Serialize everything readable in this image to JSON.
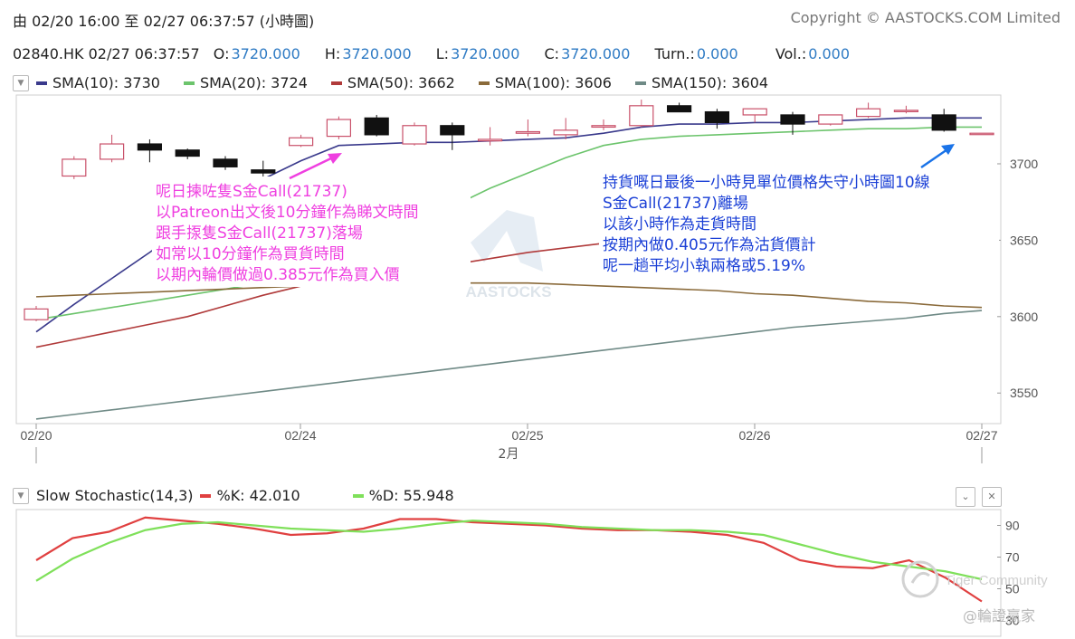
{
  "header": {
    "range_text": "由 02/20 16:00 至 02/27 06:37:57 (小時圖)",
    "copyright": "Copyright © AASTOCKS.COM Limited"
  },
  "quote": {
    "symbol_time": "02840.HK 02/27 06:37:57",
    "o_label": "O:",
    "o_value": "3720.000",
    "h_label": "H:",
    "h_value": "3720.000",
    "l_label": "L:",
    "l_value": "3720.000",
    "c_label": "C:",
    "c_value": "3720.000",
    "turn_label": "Turn.:",
    "turn_value": "0.000",
    "vol_label": "Vol.:",
    "vol_value": "0.000"
  },
  "legend": [
    {
      "label": "SMA(10): 3730",
      "color": "#3a3a8c"
    },
    {
      "label": "SMA(20): 3724",
      "color": "#6cc46c"
    },
    {
      "label": "SMA(50): 3662",
      "color": "#b03a3a"
    },
    {
      "label": "SMA(100): 3606",
      "color": "#8a6a3a"
    },
    {
      "label": "SMA(150): 3604",
      "color": "#6f8a86"
    }
  ],
  "annotations": {
    "pink": [
      "呢日揀咗隻S金Call(21737)",
      "以Patreon出文後10分鐘作為睇文時間",
      "跟手揼隻S金Call(21737)落場",
      "如常以10分鐘作為買貨時間",
      "以期內輪價做過0.385元作為買入價"
    ],
    "blue": [
      "持貨嘅日最後一小時見單位價格失守小時圖10線",
      "S金Call(21737)離場",
      "以該小時作為走貨時間",
      "按期內做0.405元作為沽貨價計",
      "呢一趟平均小執兩格或5.19%"
    ]
  },
  "watermark": "AASTOCKS",
  "stoch_header": {
    "title": "Slow Stochastic(14,3)",
    "k_label": "%K: 42.010",
    "d_label": "%D: 55.948"
  },
  "tiger": {
    "brand": "Tiger Community",
    "handle": "@輪證贏家"
  },
  "chart_data": [
    {
      "type": "candlestick",
      "y_ticks": [
        "3700",
        "3650",
        "3600",
        "3550"
      ],
      "ylim": [
        3530,
        3745
      ],
      "x_ticks": [
        "02/20",
        "02/24",
        "02/25",
        "02/26",
        "02/27"
      ],
      "x_sublabel": "2月",
      "candles": [
        {
          "o": 3598,
          "h": 3607,
          "l": 3597,
          "c": 3605
        },
        {
          "o": 3692,
          "h": 3705,
          "l": 3690,
          "c": 3703
        },
        {
          "o": 3703,
          "h": 3719,
          "l": 3701,
          "c": 3713
        },
        {
          "o": 3713,
          "h": 3716,
          "l": 3701,
          "c": 3709
        },
        {
          "o": 3709,
          "h": 3710,
          "l": 3703,
          "c": 3705
        },
        {
          "o": 3703,
          "h": 3705,
          "l": 3696,
          "c": 3698
        },
        {
          "o": 3696,
          "h": 3702,
          "l": 3690,
          "c": 3694
        },
        {
          "o": 3712,
          "h": 3719,
          "l": 3711,
          "c": 3717
        },
        {
          "o": 3718,
          "h": 3731,
          "l": 3716,
          "c": 3729
        },
        {
          "o": 3730,
          "h": 3732,
          "l": 3718,
          "c": 3719
        },
        {
          "o": 3713,
          "h": 3727,
          "l": 3712,
          "c": 3725
        },
        {
          "o": 3725,
          "h": 3727,
          "l": 3709,
          "c": 3719
        },
        {
          "o": 3715,
          "h": 3724,
          "l": 3712,
          "c": 3716
        },
        {
          "o": 3720,
          "h": 3729,
          "l": 3718,
          "c": 3721
        },
        {
          "o": 3719,
          "h": 3730,
          "l": 3716,
          "c": 3722
        },
        {
          "o": 3724,
          "h": 3729,
          "l": 3722,
          "c": 3725
        },
        {
          "o": 3725,
          "h": 3742,
          "l": 3724,
          "c": 3738
        },
        {
          "o": 3738,
          "h": 3740,
          "l": 3734,
          "c": 3734
        },
        {
          "o": 3734,
          "h": 3736,
          "l": 3723,
          "c": 3727
        },
        {
          "o": 3732,
          "h": 3736,
          "l": 3727,
          "c": 3736
        },
        {
          "o": 3732,
          "h": 3734,
          "l": 3719,
          "c": 3726
        },
        {
          "o": 3726,
          "h": 3732,
          "l": 3725,
          "c": 3732
        },
        {
          "o": 3731,
          "h": 3740,
          "l": 3730,
          "c": 3736
        },
        {
          "o": 3735,
          "h": 3738,
          "l": 3733,
          "c": 3735
        },
        {
          "o": 3732,
          "h": 3736,
          "l": 3721,
          "c": 3722
        },
        {
          "o": 3720,
          "h": 3720,
          "l": 3720,
          "c": 3720
        }
      ],
      "sma": {
        "SMA(10)": [
          3590,
          3608,
          3625,
          3642,
          3660,
          3678,
          3690,
          3702,
          3712,
          3713,
          3714,
          3714,
          3715,
          3716,
          3717,
          3720,
          3724,
          3726,
          3726,
          3727,
          3727,
          3728,
          3729,
          3730,
          3730,
          3730
        ],
        "SMA(20)": [
          3598,
          3602,
          3606,
          3610,
          3614,
          3618,
          3622,
          3630,
          3640,
          3650,
          3662,
          3672,
          3684,
          3694,
          3704,
          3712,
          3716,
          3718,
          3719,
          3720,
          3721,
          3722,
          3723,
          3723,
          3724,
          3724
        ],
        "SMA(50)": [
          3580,
          3585,
          3590,
          3595,
          3600,
          3607,
          3614,
          3620,
          3625,
          3628,
          3631,
          3634,
          3638,
          3642,
          3645,
          3648,
          3651,
          3654,
          3656,
          3658,
          3659,
          3660,
          3661,
          3661,
          3662,
          3662
        ],
        "SMA(100)": [
          3613,
          3614,
          3615,
          3616,
          3617,
          3618,
          3619,
          3620,
          3621,
          3622,
          3622,
          3622,
          3622,
          3622,
          3621,
          3620,
          3619,
          3618,
          3617,
          3615,
          3614,
          3612,
          3610,
          3609,
          3607,
          3606
        ],
        "SMA(150)": [
          3533,
          3536,
          3539,
          3542,
          3545,
          3548,
          3551,
          3554,
          3557,
          3560,
          3563,
          3566,
          3569,
          3572,
          3575,
          3578,
          3581,
          3584,
          3587,
          3590,
          3593,
          3595,
          3597,
          3599,
          3602,
          3604
        ]
      }
    },
    {
      "type": "line",
      "title": "Slow Stochastic(14,3)",
      "y_ticks": [
        "90",
        "70",
        "50",
        "30"
      ],
      "ylim": [
        20,
        100
      ],
      "series": [
        {
          "name": "%K",
          "color": "#e04040",
          "values": [
            68,
            82,
            86,
            95,
            93,
            91,
            88,
            84,
            85,
            88,
            94,
            94,
            92,
            91,
            90,
            88,
            87,
            87,
            86,
            84,
            79,
            68,
            64,
            63,
            68,
            57,
            42
          ]
        },
        {
          "name": "%D",
          "color": "#7fe05a",
          "values": [
            55,
            69,
            79,
            87,
            91,
            92,
            90,
            88,
            87,
            86,
            88,
            91,
            93,
            92,
            91,
            89,
            88,
            87,
            87,
            86,
            84,
            78,
            72,
            67,
            64,
            61,
            56
          ]
        }
      ]
    }
  ]
}
